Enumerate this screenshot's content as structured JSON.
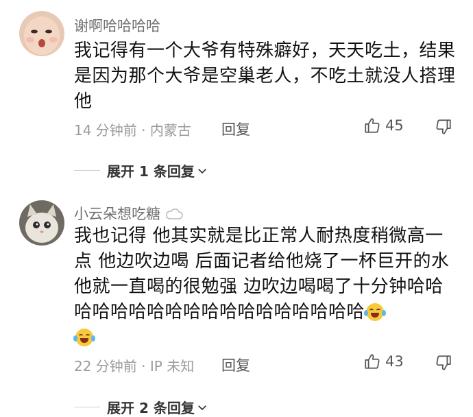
{
  "comments": [
    {
      "username": "谢啊哈哈哈哈",
      "text": "我记得有一个大爷有特殊癖好，天天吃土，结果是因为那个大爷是空巢老人，不吃土就没人搭理他",
      "time_location": "14 分钟前 · 内蒙古",
      "reply_label": "回复",
      "likes": "45",
      "expand_label": "展开 1 条回复"
    },
    {
      "username": "小云朵想吃糖",
      "text": "我也记得 他其实就是比正常人耐热度稍微高一点 他边吹边喝 后面记者给他烧了一杯巨开的水他就一直喝的很勉强 边吹边喝喝了十分钟哈哈哈哈哈哈哈哈哈哈哈哈哈哈哈哈哈哈",
      "time_location": "22 分钟前 · IP 未知",
      "reply_label": "回复",
      "likes": "43",
      "expand_label": "展开 2 条回复"
    }
  ],
  "colors": {
    "username": "#707070",
    "meta": "#9a9a9a",
    "text": "#111111",
    "emoji": "#f6c93e"
  },
  "icons": [
    "thumbs-up-icon",
    "thumbs-down-icon",
    "chevron-down-icon",
    "cloud-icon",
    "laughing-crying-emoji-icon"
  ]
}
